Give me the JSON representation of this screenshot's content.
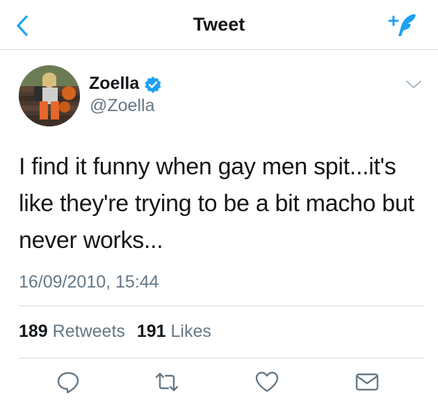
{
  "nav": {
    "title": "Tweet",
    "back_icon": "chevron-left-icon",
    "compose_icon": "compose-tweet-icon"
  },
  "tweet": {
    "author_name": "Zoella",
    "author_handle": "@Zoella",
    "verified": true,
    "text": "I find it funny when gay men spit...it's like they're trying to be a bit macho but never works...",
    "timestamp": "16/09/2010, 15:44"
  },
  "stats": {
    "retweets_count": "189",
    "retweets_label": "Retweets",
    "likes_count": "191",
    "likes_label": "Likes"
  },
  "actions": [
    "reply-icon",
    "retweet-icon",
    "like-icon",
    "share-dm-icon"
  ],
  "colors": {
    "accent": "#1da1f2",
    "text": "#14171a",
    "secondary_text": "#657786",
    "icon_gray": "#657786",
    "divider": "#d8dde1"
  }
}
